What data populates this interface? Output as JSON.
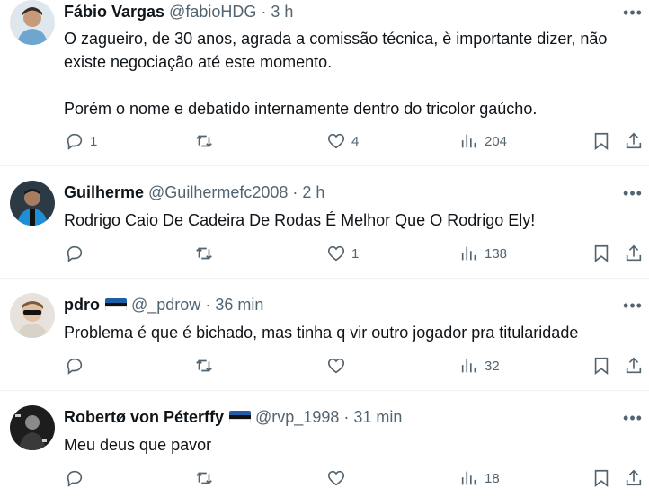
{
  "tweets": [
    {
      "name": "Fábio Vargas",
      "handle": "@fabioHDG",
      "sep": "·",
      "time": "3 h",
      "flag": false,
      "lines": [
        "O zagueiro, de 30 anos, agrada a comissão técnica, è importante dizer, não",
        "existe negociação até este momento.",
        "",
        "Porém o nome e debatido internamente dentro do tricolor gaúcho."
      ],
      "replies": "1",
      "retweets": "",
      "likes": "4",
      "views": "204",
      "avatar_color": "#5b8fb4"
    },
    {
      "name": "Guilherme",
      "handle": "@Guilhermefc2008",
      "sep": "·",
      "time": "2 h",
      "flag": false,
      "lines": [
        "Rodrigo Caio De Cadeira De Rodas É Melhor Que O Rodrigo Ely!"
      ],
      "replies": "",
      "retweets": "",
      "likes": "1",
      "views": "138",
      "avatar_color": "#2c3a46"
    },
    {
      "name": "pdro",
      "handle": "@_pdrow",
      "sep": "·",
      "time": "36 min",
      "flag": true,
      "lines": [
        "Problema é que é bichado, mas tinha q vir outro jogador pra titularidade"
      ],
      "replies": "",
      "retweets": "",
      "likes": "",
      "views": "32",
      "avatar_color": "#c9b8a6"
    },
    {
      "name": "Robertø von Péterffy",
      "handle": "@rvp_1998",
      "sep": "·",
      "time": "31 min",
      "flag": true,
      "lines": [
        "Meu deus que pavor"
      ],
      "replies": "",
      "retweets": "",
      "likes": "",
      "views": "18",
      "avatar_color": "#1d1d1d"
    }
  ],
  "flag_colors": [
    "#1f5fa8",
    "#111111",
    "#ffffff"
  ],
  "icons": {
    "reply": "reply-icon",
    "retweet": "retweet-icon",
    "like": "like-icon",
    "views": "views-icon",
    "bookmark": "bookmark-icon",
    "share": "share-icon",
    "more": "more-icon"
  },
  "more_glyph": "•••"
}
